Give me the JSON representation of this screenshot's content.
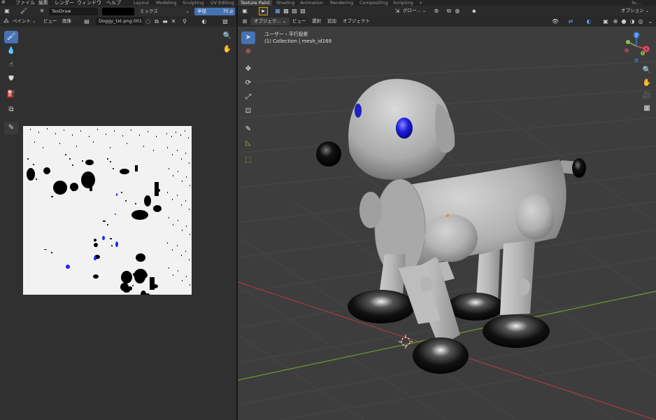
{
  "menu": {
    "items": [
      "ファイル",
      "編集",
      "レンダー",
      "ウィンドウ",
      "ヘルプ"
    ],
    "workspaces": [
      "Layout",
      "Modeling",
      "Sculpting",
      "UV Editing",
      "Texture Paint",
      "Shading",
      "Animation",
      "Rendering",
      "Compositing",
      "Scripting"
    ],
    "active_workspace": "Texture Paint",
    "add_tab": "+",
    "scene_label": "Sc..."
  },
  "paint_header": {
    "brush_name": "TexDraw",
    "blend_mode": "ミックス",
    "radius_label": "半径",
    "radius_value": "75 p"
  },
  "image_editor": {
    "mode": "ペイント",
    "menus": [
      "ビュー",
      "画像"
    ],
    "image_name": "Doggy_txt.png.001"
  },
  "viewport_header": {
    "orientation": "グロー...",
    "options": "オプション",
    "object_mode": "オブジェク...",
    "menus": [
      "ビュー",
      "選択",
      "追加",
      "オブジェクト"
    ]
  },
  "viewport_overlay": {
    "view_name": "ユーザー・平行投影",
    "collection_info": "(1) Collection | mesh_id169"
  },
  "gizmo": {
    "x": "X",
    "y": "Y",
    "z": "Z"
  },
  "colors": {
    "accent": "#4772b3",
    "axis_x": "#e84a5f",
    "axis_y": "#8bc34a",
    "axis_z": "#3a7bd5",
    "texture_blue": "#2222ff"
  }
}
